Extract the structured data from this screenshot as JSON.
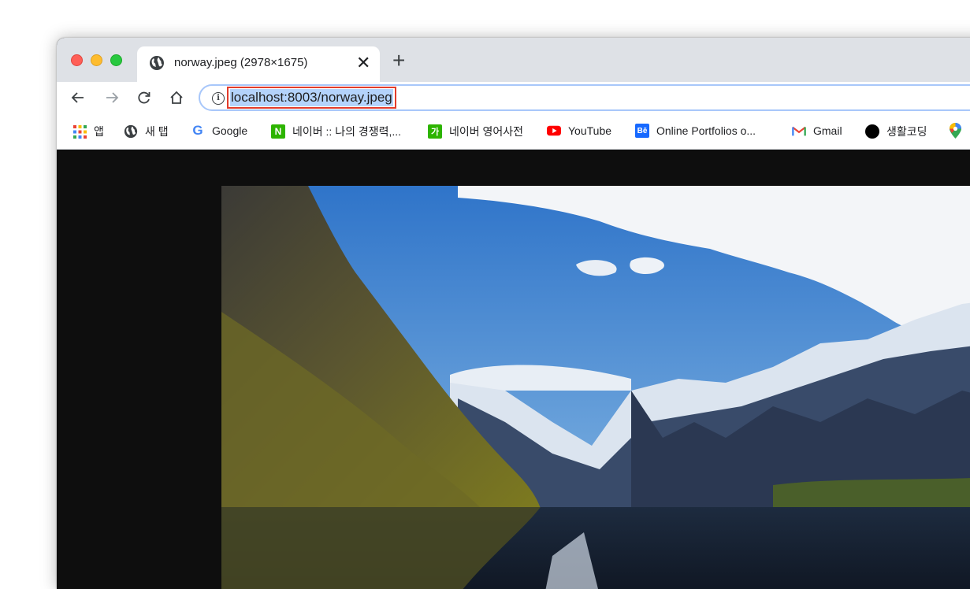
{
  "tab": {
    "title": "norway.jpeg (2978×1675)",
    "close_glyph": "✕",
    "new_tab_glyph": "+"
  },
  "toolbar": {
    "back_icon": "back-arrow-icon",
    "forward_icon": "forward-arrow-icon",
    "reload_icon": "reload-icon",
    "home_icon": "home-icon",
    "info_glyph": "i",
    "url": "localhost:8003/norway.jpeg"
  },
  "bookmarks": [
    {
      "label": "앱",
      "icon": "apps-grid-icon"
    },
    {
      "label": "새 탭",
      "icon": "globe-icon"
    },
    {
      "label": "Google",
      "icon": "google-g-icon"
    },
    {
      "label": "네이버 :: 나의 경쟁력,...",
      "icon": "naver-n-icon",
      "icon_text": "N"
    },
    {
      "label": "네이버 영어사전",
      "icon": "naver-dict-icon",
      "icon_text": "가"
    },
    {
      "label": "YouTube",
      "icon": "youtube-icon"
    },
    {
      "label": "Online Portfolios o...",
      "icon": "behance-icon",
      "icon_text": "Bē"
    },
    {
      "label": "Gmail",
      "icon": "gmail-icon"
    },
    {
      "label": "생활코딩",
      "icon": "black-circle-icon"
    },
    {
      "label": "",
      "icon": "maps-pin-icon"
    }
  ],
  "content": {
    "image": "norway-fjord-photo"
  },
  "colors": {
    "highlight_box": "#e23b2b",
    "url_selection": "#b4d3fb",
    "omnibox_border": "#a8c7fa",
    "tabbar": "#dee1e6"
  }
}
